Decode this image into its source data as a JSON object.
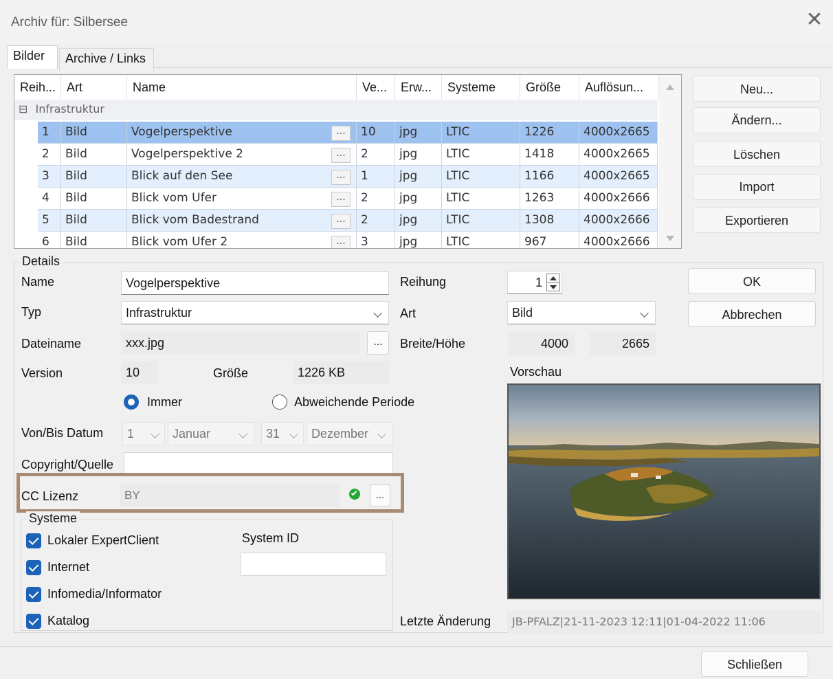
{
  "window": {
    "title": "Archiv für: Silbersee",
    "close_glyph": "✕"
  },
  "tabs": [
    {
      "label": "Bilder"
    },
    {
      "label": "Archive / Links"
    }
  ],
  "grid": {
    "columns": [
      "Reih...",
      "Art",
      "Name",
      "Ve...",
      "Erw...",
      "Systeme",
      "Größe",
      "Auflösun..."
    ],
    "group": {
      "toggle": "⊟",
      "label": "Infrastruktur"
    },
    "ellipsis": "...",
    "rows": [
      {
        "nr": "1",
        "art": "Bild",
        "name": "Vogelperspektive",
        "ver": "10",
        "ext": "jpg",
        "sys": "LTIC",
        "size": "1226",
        "res": "4000x2665"
      },
      {
        "nr": "2",
        "art": "Bild",
        "name": "Vogelperspektive 2",
        "ver": "2",
        "ext": "jpg",
        "sys": "LTIC",
        "size": "1418",
        "res": "4000x2665"
      },
      {
        "nr": "3",
        "art": "Bild",
        "name": "Blick auf den See",
        "ver": "1",
        "ext": "jpg",
        "sys": "LTIC",
        "size": "1166",
        "res": "4000x2665"
      },
      {
        "nr": "4",
        "art": "Bild",
        "name": "Blick vom Ufer",
        "ver": "2",
        "ext": "jpg",
        "sys": "LTIC",
        "size": "1263",
        "res": "4000x2666"
      },
      {
        "nr": "5",
        "art": "Bild",
        "name": "Blick vom Badestrand",
        "ver": "2",
        "ext": "jpg",
        "sys": "LTIC",
        "size": "1308",
        "res": "4000x2666"
      },
      {
        "nr": "6",
        "art": "Bild",
        "name": "Blick vom Ufer 2",
        "ver": "3",
        "ext": "jpg",
        "sys": "LTIC",
        "size": "967",
        "res": "4000x2666"
      }
    ]
  },
  "side_buttons": {
    "new": "Neu...",
    "edit": "Ändern...",
    "delete": "Löschen",
    "import": "Import",
    "export": "Exportieren"
  },
  "details": {
    "legend": "Details",
    "name_label": "Name",
    "name_value": "Vogelperspektive",
    "typ_label": "Typ",
    "typ_value": "Infrastruktur",
    "dateiname_label": "Dateiname",
    "dateiname_value": "xxx.jpg",
    "browse": "...",
    "version_label": "Version",
    "version_value": "10",
    "groesse_label": "Größe",
    "groesse_value": "1226 KB",
    "radio_immer": "Immer",
    "radio_periode": "Abweichende Periode",
    "datum_label": "Von/Bis Datum",
    "from_day": "1",
    "from_month": "Januar",
    "to_day": "31",
    "to_month": "Dezember",
    "copyright_label": "Copyright/Quelle",
    "copyright_value": "",
    "cc_label": "CC Lizenz",
    "cc_value": "BY",
    "cc_browse": "...",
    "reihung_label": "Reihung",
    "reihung_value": "1",
    "art_label": "Art",
    "art_value": "Bild",
    "bh_label": "Breite/Höhe",
    "breite": "4000",
    "hoehe": "2665",
    "vorschau_label": "Vorschau",
    "letzte_label": "Letzte Änderung",
    "letzte_value": "JB-PFALZ|21-11-2023 12:11|01-04-2022 11:06"
  },
  "systeme": {
    "legend": "Systeme",
    "items": [
      "Lokaler ExpertClient",
      "Internet",
      "Infomedia/Informator",
      "Katalog"
    ],
    "system_id_label": "System ID",
    "system_id_value": ""
  },
  "dialog_buttons": {
    "ok": "OK",
    "cancel": "Abbrechen",
    "close": "Schließen"
  },
  "colors": {
    "selection": "#9ec2f0",
    "row_alt": "#e4effd",
    "checkbox": "#1c63b8",
    "highlight_frame": "#a98a72",
    "status_ok": "#22a830"
  }
}
